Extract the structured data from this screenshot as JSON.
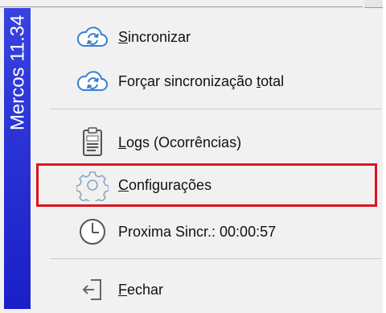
{
  "sidebar": {
    "title": "Mercos 11.34",
    "color": "#2a31d6"
  },
  "menu": {
    "items": [
      {
        "label": "Sincronizar",
        "accel": "S",
        "icon": "cloud-sync-icon"
      },
      {
        "label": "Forçar sincronização total",
        "accel": "t",
        "icon": "cloud-sync-icon"
      },
      {
        "label": "Logs (Ocorrências)",
        "accel": "L",
        "icon": "clipboard-icon"
      },
      {
        "label": "Configurações",
        "accel": "C",
        "icon": "gear-icon"
      },
      {
        "label": "Proxima Sincr.:  00:00:57",
        "icon": "clock-icon"
      },
      {
        "label": "Fechar",
        "accel": "F",
        "icon": "exit-icon"
      }
    ],
    "highlight_color": "#e0131f"
  }
}
